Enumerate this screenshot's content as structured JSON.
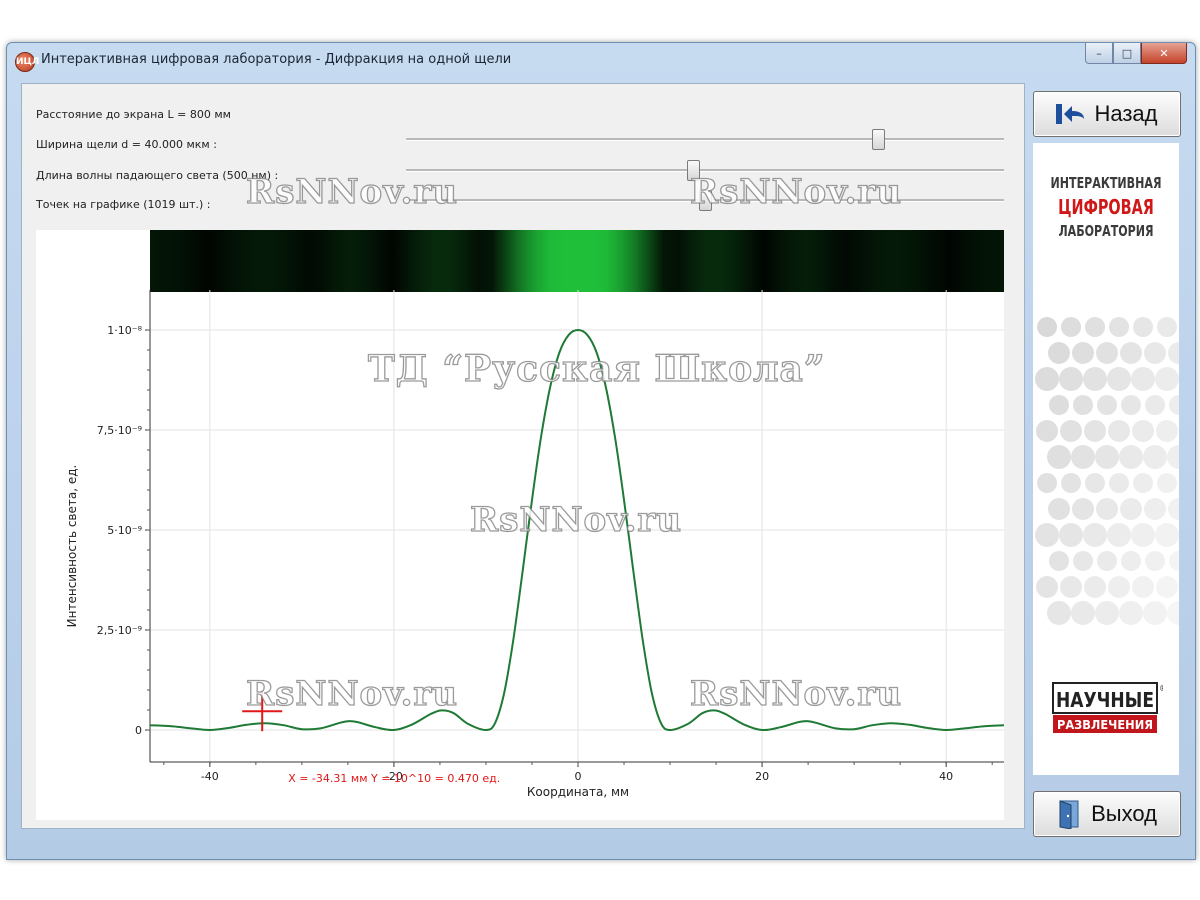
{
  "window": {
    "title": "Интерактивная цифровая лаборатория - Дифракция на одной щели",
    "app_icon_text": "ИЦЛ",
    "controls": {
      "minimize": "–",
      "maximize": "□",
      "close": "✕"
    }
  },
  "parameters": {
    "distance": {
      "label": "Расстояние до экрана L = 800 мм"
    },
    "slit_width": {
      "label": "Ширина щели d = 40.000 мкм :",
      "value_fraction": 0.79
    },
    "wavelength": {
      "label": "Длина волны падающего света (500 нм) :",
      "value_fraction": 0.48
    },
    "points": {
      "label": "Точек на графике (1019 шт.) :",
      "value_fraction": 0.5
    }
  },
  "spectrum_strip": {
    "color": "#1fbf3a"
  },
  "chart_data": {
    "type": "line",
    "xlabel": "Координата, мм",
    "ylabel": "Интенсивность света, ед.",
    "xlim": [
      -46.5,
      46.5
    ],
    "ylim": [
      -8e-11,
      1.1e-09
    ],
    "x_ticks": [
      -40,
      -20,
      0,
      20,
      40
    ],
    "x_tick_labels": [
      "-40",
      "-20",
      "0",
      "20",
      "40"
    ],
    "y_ticks": [
      0,
      2.5e-10,
      5e-10,
      7.5e-10,
      1e-09
    ],
    "y_tick_labels": [
      "0",
      "2,5·10⁻⁹",
      "5·10⁻⁹",
      "7,5·10⁻⁹",
      "1·10⁻⁸"
    ],
    "grid": true,
    "series": [
      {
        "color": "#1e7a34",
        "points": [
          [
            -46.5,
            0.012
          ],
          [
            -44,
            0.009
          ],
          [
            -42,
            0.004
          ],
          [
            -40,
            0.0
          ],
          [
            -38,
            0.005
          ],
          [
            -36,
            0.013
          ],
          [
            -34,
            0.017
          ],
          [
            -32,
            0.012
          ],
          [
            -30,
            0.002
          ],
          [
            -28,
            0.004
          ],
          [
            -26,
            0.017
          ],
          [
            -25,
            0.022
          ],
          [
            -24,
            0.02
          ],
          [
            -22,
            0.007
          ],
          [
            -20,
            0.0
          ],
          [
            -18,
            0.014
          ],
          [
            -16,
            0.04
          ],
          [
            -14.8,
            0.049
          ],
          [
            -13.5,
            0.042
          ],
          [
            -12,
            0.016
          ],
          [
            -10,
            0.0
          ],
          [
            -9,
            0.018
          ],
          [
            -8,
            0.095
          ],
          [
            -7,
            0.23
          ],
          [
            -6,
            0.4
          ],
          [
            -5,
            0.575
          ],
          [
            -4,
            0.735
          ],
          [
            -3,
            0.86
          ],
          [
            -2,
            0.945
          ],
          [
            -1,
            0.988
          ],
          [
            0,
            1.0
          ],
          [
            1,
            0.988
          ],
          [
            2,
            0.945
          ],
          [
            3,
            0.86
          ],
          [
            4,
            0.735
          ],
          [
            5,
            0.575
          ],
          [
            6,
            0.4
          ],
          [
            7,
            0.23
          ],
          [
            8,
            0.095
          ],
          [
            9,
            0.018
          ],
          [
            10,
            0.0
          ],
          [
            12,
            0.016
          ],
          [
            13.5,
            0.042
          ],
          [
            14.8,
            0.049
          ],
          [
            16,
            0.04
          ],
          [
            18,
            0.014
          ],
          [
            20,
            0.0
          ],
          [
            22,
            0.007
          ],
          [
            24,
            0.02
          ],
          [
            25,
            0.022
          ],
          [
            26,
            0.017
          ],
          [
            28,
            0.004
          ],
          [
            30,
            0.002
          ],
          [
            32,
            0.012
          ],
          [
            34,
            0.017
          ],
          [
            36,
            0.013
          ],
          [
            38,
            0.005
          ],
          [
            40,
            0.0
          ],
          [
            42,
            0.004
          ],
          [
            44,
            0.009
          ],
          [
            46.5,
            0.012
          ]
        ],
        "y_scale": 1e-09
      }
    ],
    "cursor": {
      "x": -34.31,
      "y": 4.7e-11,
      "readout": "X = -34.31 мм   Y = 10^10 = 0.470 ед."
    }
  },
  "sidebar": {
    "back_label": "Назад",
    "brand": {
      "line1": "ИНТЕРАКТИВНАЯ",
      "line2": "ЦИФРОВАЯ",
      "line3": "ЛАБОРАТОРИЯ"
    },
    "publisher_logo": {
      "line1": "НАУЧНЫЕ",
      "line2": "РАЗВЛЕЧЕНИЯ",
      "mark": "®"
    },
    "exit_label": "Выход"
  },
  "watermarks": {
    "site": "RsNNov.ru",
    "publisher": "ТД “Русская Школа”"
  }
}
